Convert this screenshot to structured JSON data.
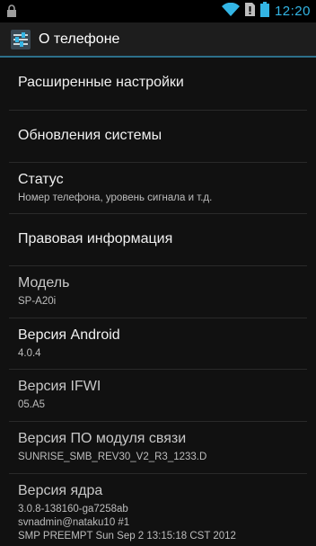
{
  "status_bar": {
    "time": "12:20",
    "time_color": "#33b5e5",
    "icons": [
      "lock-icon",
      "wifi-icon",
      "sim-alert-icon",
      "battery-icon"
    ]
  },
  "action_bar": {
    "title": "О телефоне",
    "icon": "settings-sliders-icon"
  },
  "items": [
    {
      "title": "Расширенные настройки"
    },
    {
      "title": "Обновления системы"
    },
    {
      "title": "Статус",
      "subtitle": "Номер телефона, уровень сигнала и т.д."
    },
    {
      "title": "Правовая информация"
    },
    {
      "title": "Модель",
      "subtitle": "SP-A20i"
    },
    {
      "title": "Версия Android",
      "subtitle": "4.0.4"
    },
    {
      "title": "Версия IFWI",
      "subtitle": "05.A5"
    },
    {
      "title": "Версия ПО модуля связи",
      "subtitle": "SUNRISE_SMB_REV30_V2_R3_1233.D"
    },
    {
      "title": "Версия ядра",
      "subtitle_lines": [
        "3.0.8-138160-ga7258ab",
        "svnadmin@nataku10 #1",
        "SMP PREEMPT Sun Sep 2 13:15:18 CST 2012"
      ]
    }
  ]
}
